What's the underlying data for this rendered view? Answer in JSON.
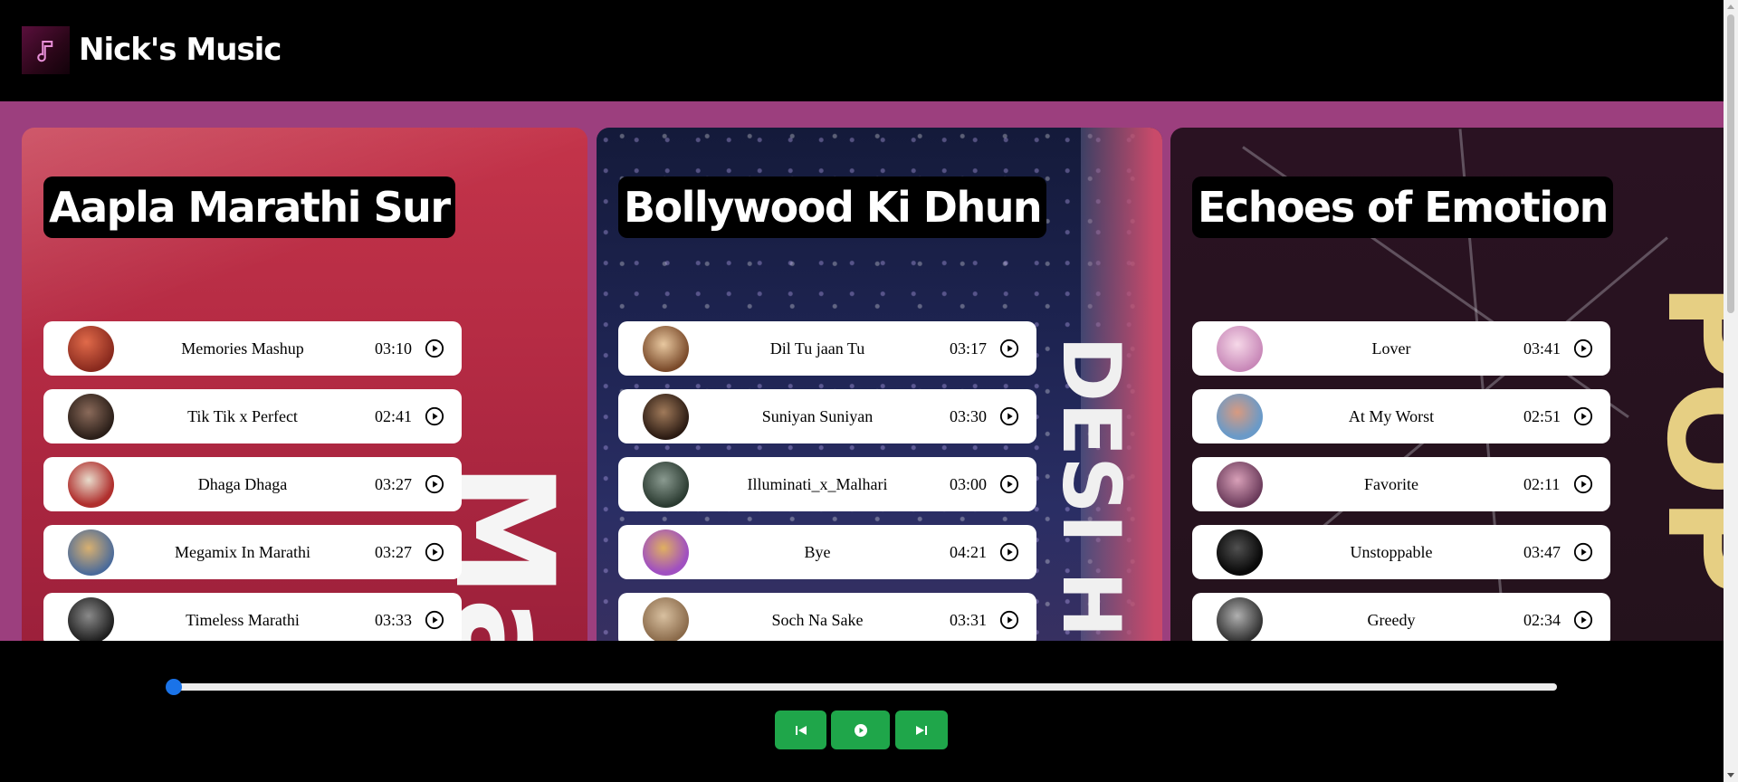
{
  "app": {
    "title": "Nick's Music",
    "logo_icon": "music-note-icon"
  },
  "playlists": [
    {
      "title": "Aapla Marathi Sur",
      "songs": [
        {
          "name": "Memories Mashup",
          "duration": "03:10",
          "thumb_color": "#b03a2e"
        },
        {
          "name": "Tik Tik x Perfect",
          "duration": "02:41",
          "thumb_color": "#4a3a30"
        },
        {
          "name": "Dhaga Dhaga",
          "duration": "03:27",
          "thumb_color": "#b0302e"
        },
        {
          "name": "Megamix In Marathi",
          "duration": "03:27",
          "thumb_color": "#4a6a9a"
        },
        {
          "name": "Timeless Marathi",
          "duration": "03:33",
          "thumb_color": "#2a2a2a"
        }
      ]
    },
    {
      "title": "Bollywood Ki Dhun",
      "songs": [
        {
          "name": "Dil Tu jaan Tu",
          "duration": "03:17",
          "thumb_color": "#8a5a3a"
        },
        {
          "name": "Suniyan Suniyan",
          "duration": "03:30",
          "thumb_color": "#3a2a20"
        },
        {
          "name": "Illuminati_x_Malhari",
          "duration": "03:00",
          "thumb_color": "#3a4a40"
        },
        {
          "name": "Bye",
          "duration": "04:21",
          "thumb_color": "#a85ac0"
        },
        {
          "name": "Soch Na Sake",
          "duration": "03:31",
          "thumb_color": "#a88a6a"
        }
      ]
    },
    {
      "title": "Echoes of Emotion",
      "songs": [
        {
          "name": "Lover",
          "duration": "03:41",
          "thumb_color": "#e8a8c8"
        },
        {
          "name": "At My Worst",
          "duration": "02:51",
          "thumb_color": "#8ab0d8"
        },
        {
          "name": "Favorite",
          "duration": "02:11",
          "thumb_color": "#9a6080"
        },
        {
          "name": "Unstoppable",
          "duration": "03:47",
          "thumb_color": "#101010"
        },
        {
          "name": "Greedy",
          "duration": "02:34",
          "thumb_color": "#404040"
        }
      ]
    }
  ],
  "background_art": {
    "card1": "Ma",
    "card2": "DESI HI",
    "card3": "POP"
  },
  "player": {
    "progress": 0,
    "controls": {
      "prev_icon": "previous-track-icon",
      "play_icon": "play-icon",
      "next_icon": "next-track-icon"
    }
  },
  "colors": {
    "page_bg": "#9c3f7e",
    "header_bg": "#000000",
    "control_green": "#1fa64a",
    "progress_accent": "#1a73e8"
  }
}
